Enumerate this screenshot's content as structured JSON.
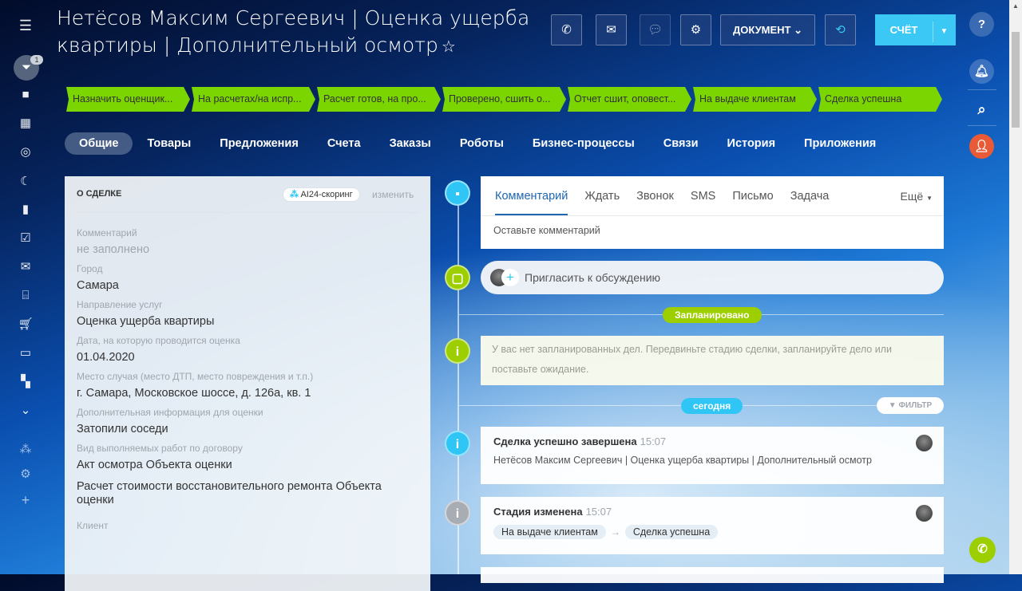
{
  "header": {
    "title": "Нетёсов Максим Сергеевич | Оценка ущерба квартиры | Дополнительный осмотр",
    "document_label": "ДОКУМЕНТ",
    "invoice_label": "СЧЁТ"
  },
  "left_sidebar": {
    "counter_badge": "1"
  },
  "stages": [
    "Назначить оценщик...",
    "На расчетах/на испр...",
    "Расчет готов, на про...",
    "Проверено, сшить о...",
    "Отчет сшит, оповест...",
    "На выдаче клиентам",
    "Сделка успешна"
  ],
  "stage_color": "#7bd500",
  "tabs": [
    "Общие",
    "Товары",
    "Предложения",
    "Счета",
    "Заказы",
    "Роботы",
    "Бизнес-процессы",
    "Связи",
    "История",
    "Приложения"
  ],
  "deal": {
    "heading": "О СДЕЛКЕ",
    "scoring": "AI24-скоринг",
    "edit": "изменить",
    "fields": [
      {
        "label": "Комментарий",
        "value": "не заполнено"
      },
      {
        "label": "Город",
        "value": "Самара"
      },
      {
        "label": "Направление услуг",
        "value": "Оценка ущерба квартиры"
      },
      {
        "label": "Дата, на которую проводится оценка",
        "value": "01.04.2020"
      },
      {
        "label": "Место случая (место ДТП, место повреждения и т.п.)",
        "value": "г. Самара, Московское шоссе, д. 126а, кв. 1"
      },
      {
        "label": "Дополнительная информация для оценки",
        "value": "Затопили соседи"
      },
      {
        "label": "Вид выполняемых работ по договору",
        "value": "Акт осмотра Объекта оценки",
        "value2": "Расчет стоимости восстановительного ремонта Объекта оценки"
      },
      {
        "label": "Клиент"
      }
    ]
  },
  "timeline": {
    "editor_tabs": [
      "Комментарий",
      "Ждать",
      "Звонок",
      "SMS",
      "Письмо",
      "Задача"
    ],
    "more": "Ещё",
    "placeholder": "Оставьте комментарий",
    "invite": "Пригласить к обсуждению",
    "planned": "Запланировано",
    "no_plans": "У вас нет запланированных дел. Передвиньте стадию сделки, запланируйте дело или поставьте ожидание.",
    "today": "сегодня",
    "filter": "ФИЛЬТР",
    "events": [
      {
        "title": "Сделка успешно завершена",
        "time": "15:07",
        "text": "Нетёсов Максим Сергеевич | Оценка ущерба квартиры | Дополнительный осмотр"
      },
      {
        "title": "Стадия изменена",
        "time": "15:07",
        "from": "На выдаче клиентам",
        "to": "Сделка успешна"
      }
    ]
  }
}
